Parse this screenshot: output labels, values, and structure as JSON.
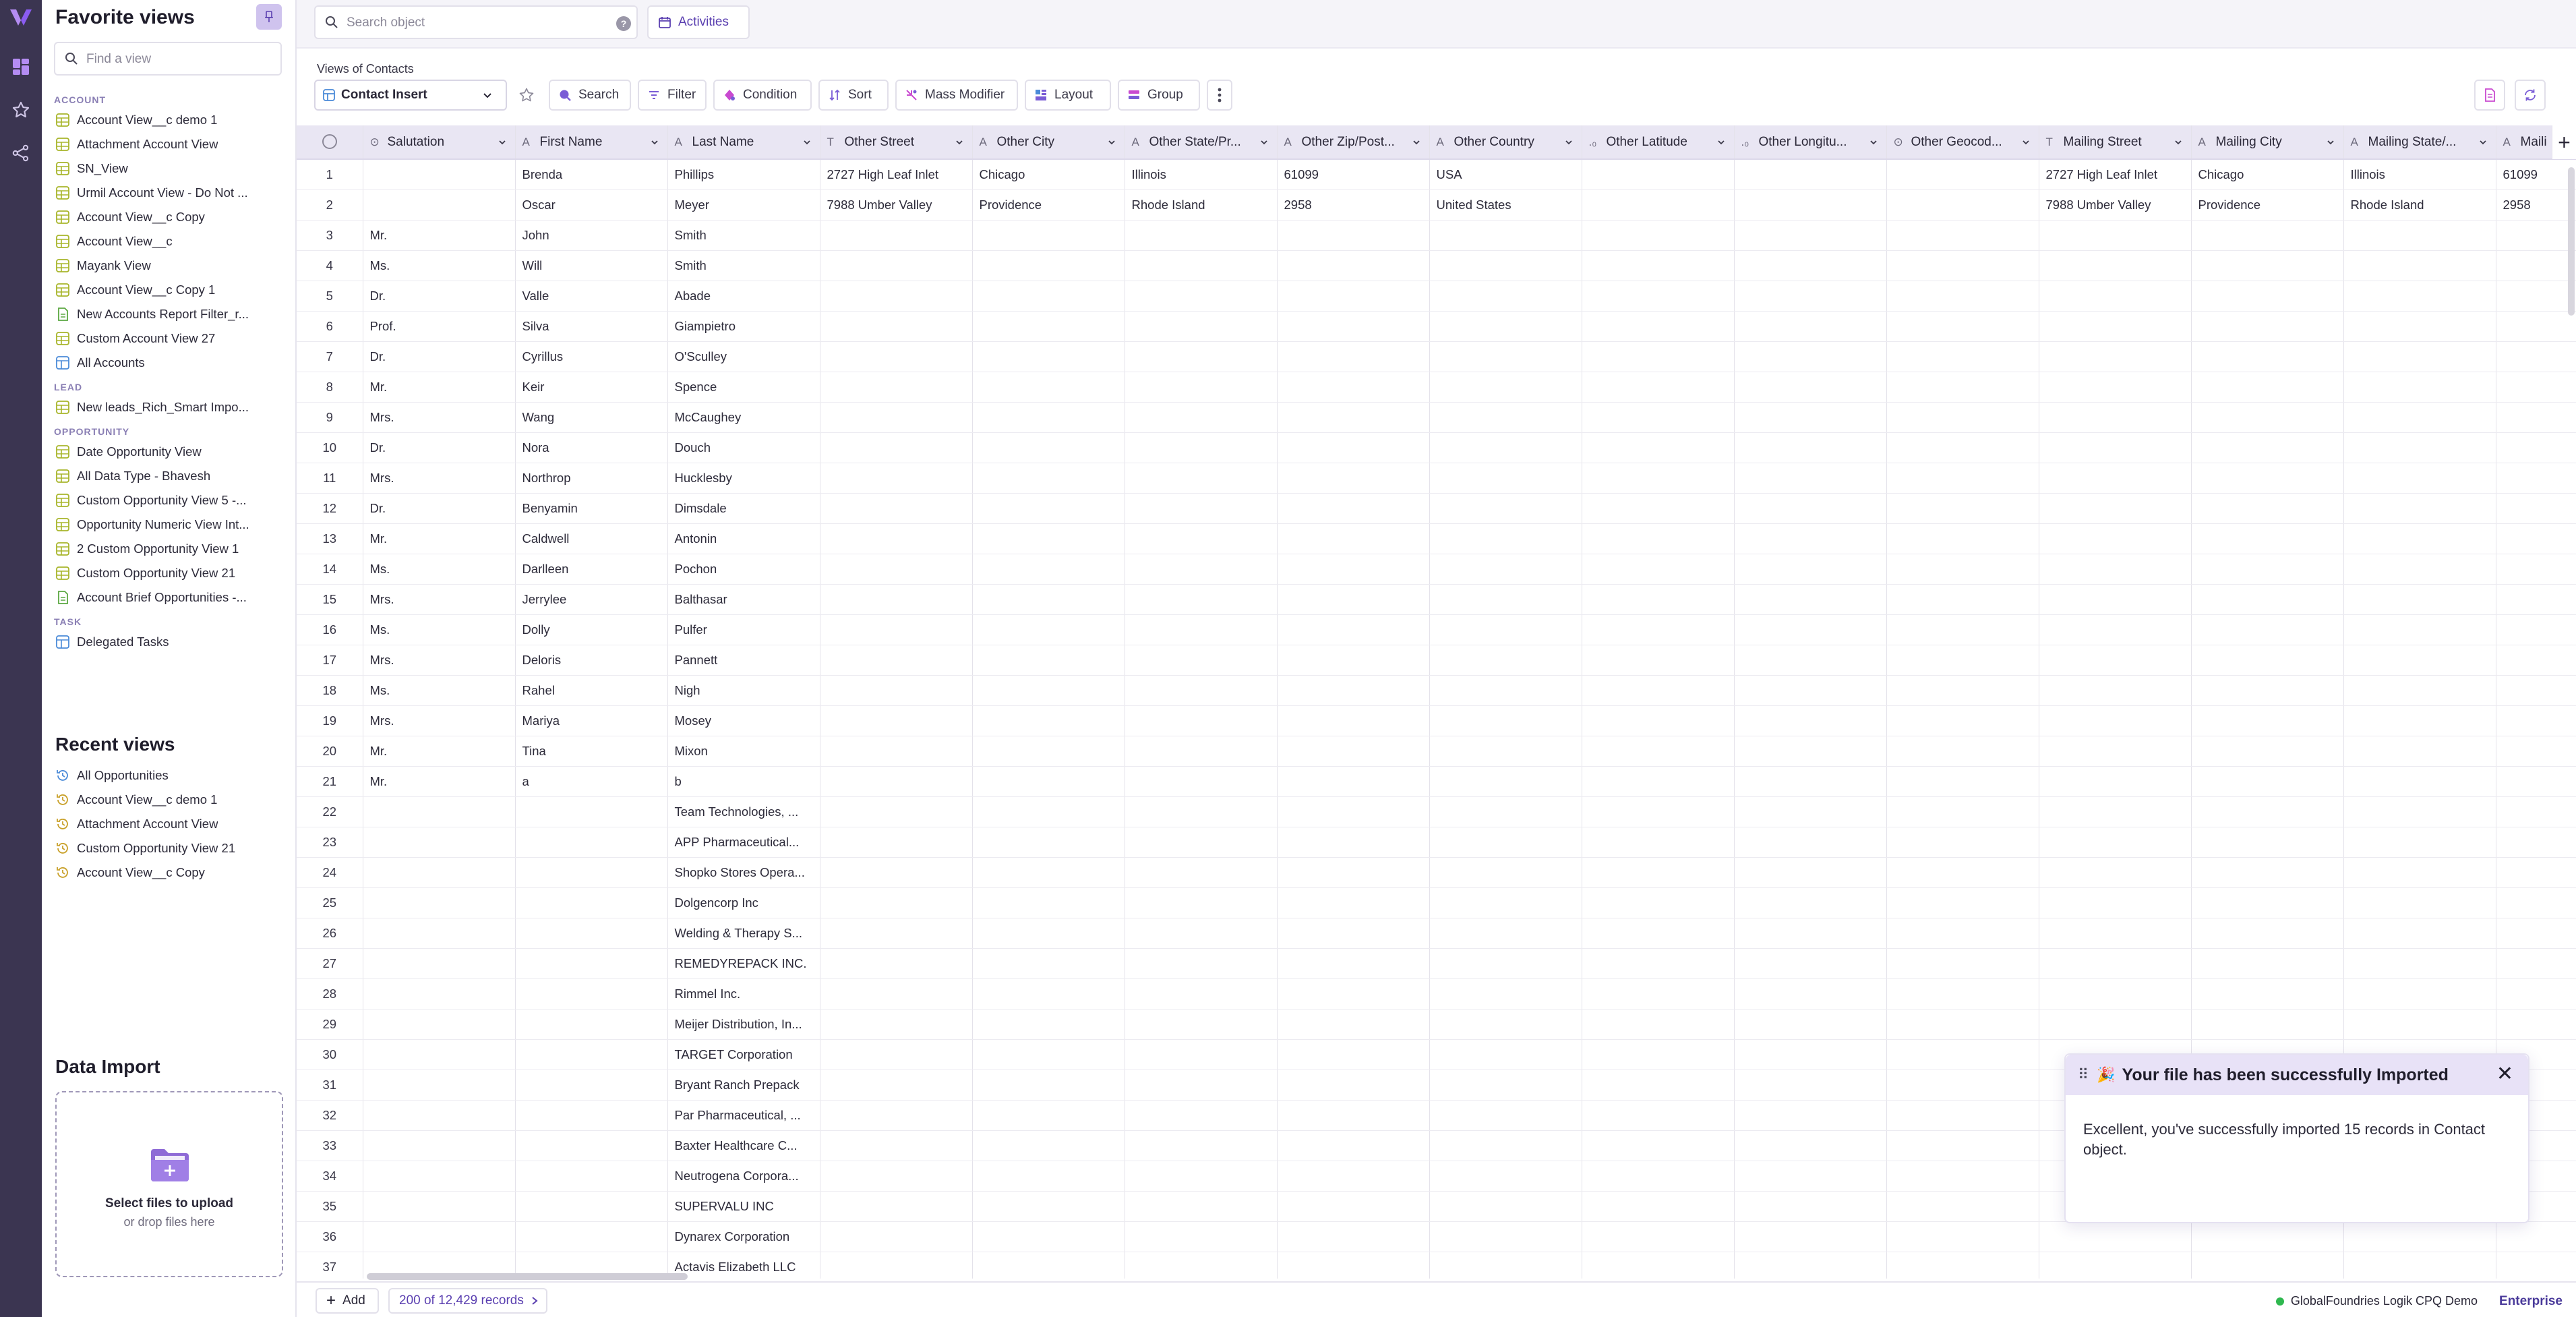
{
  "favorites": {
    "title": "Favorite views",
    "find_placeholder": "Find a view",
    "sections": [
      {
        "label": "ACCOUNT",
        "items": [
          {
            "label": "Account View__c demo 1",
            "icon": "grid-view-icon"
          },
          {
            "label": "Attachment Account View",
            "icon": "grid-view-icon"
          },
          {
            "label": "SN_View",
            "icon": "grid-view-icon"
          },
          {
            "label": "Urmil Account View - Do Not ...",
            "icon": "grid-view-icon"
          },
          {
            "label": "Account View__c Copy",
            "icon": "grid-view-icon"
          },
          {
            "label": "Account View__c",
            "icon": "grid-view-icon"
          },
          {
            "label": "Mayank View",
            "icon": "grid-view-icon"
          },
          {
            "label": "Account View__c Copy 1",
            "icon": "grid-view-icon"
          },
          {
            "label": "New Accounts Report Filter_r...",
            "icon": "report-view-icon"
          },
          {
            "label": "Custom Account View 27",
            "icon": "grid-view-icon"
          },
          {
            "label": "All Accounts",
            "icon": "list-view-icon"
          }
        ]
      },
      {
        "label": "LEAD",
        "items": [
          {
            "label": "New leads_Rich_Smart Impo...",
            "icon": "grid-view-icon"
          }
        ]
      },
      {
        "label": "OPPORTUNITY",
        "items": [
          {
            "label": "Date Opportunity View",
            "icon": "grid-view-icon"
          },
          {
            "label": "All Data Type - Bhavesh",
            "icon": "grid-view-icon"
          },
          {
            "label": "Custom Opportunity View 5 -...",
            "icon": "grid-view-icon"
          },
          {
            "label": "Opportunity Numeric View Int...",
            "icon": "grid-view-icon"
          },
          {
            "label": "2 Custom Opportunity View 1",
            "icon": "grid-view-icon"
          },
          {
            "label": "Custom Opportunity View 21",
            "icon": "grid-view-icon"
          },
          {
            "label": "Account Brief Opportunities -...",
            "icon": "report-view-icon"
          }
        ]
      },
      {
        "label": "TASK",
        "items": [
          {
            "label": "Delegated Tasks",
            "icon": "list-view-icon"
          }
        ]
      }
    ]
  },
  "recent": {
    "title": "Recent views",
    "items": [
      {
        "label": "All Opportunities",
        "icon": "history-blue-icon"
      },
      {
        "label": "Account View__c demo 1",
        "icon": "history-icon"
      },
      {
        "label": "Attachment Account View",
        "icon": "history-icon"
      },
      {
        "label": "Custom Opportunity View 21",
        "icon": "history-icon"
      },
      {
        "label": "Account View__c Copy",
        "icon": "history-icon"
      }
    ]
  },
  "data_import": {
    "title": "Data Import",
    "select_label": "Select files to upload",
    "drop_label": "or drop files here"
  },
  "topbar": {
    "search_placeholder": "Search object",
    "help": "?",
    "activities_label": "Activities"
  },
  "views_of": "Views of Contacts",
  "toolbar": {
    "view_name": "Contact Insert",
    "search": "Search",
    "filter": "Filter",
    "condition": "Condition",
    "sort": "Sort",
    "mass_modifier": "Mass Modifier",
    "layout": "Layout",
    "group": "Group"
  },
  "columns": [
    {
      "label": "Salutation",
      "icon": "picklist-icon"
    },
    {
      "label": "First Name",
      "icon": "text-icon"
    },
    {
      "label": "Last Name",
      "icon": "text-icon"
    },
    {
      "label": "Other Street",
      "icon": "textarea-icon"
    },
    {
      "label": "Other City",
      "icon": "text-icon"
    },
    {
      "label": "Other State/Pr...",
      "icon": "text-icon"
    },
    {
      "label": "Other Zip/Post...",
      "icon": "text-icon"
    },
    {
      "label": "Other Country",
      "icon": "text-icon"
    },
    {
      "label": "Other Latitude",
      "icon": "number-icon"
    },
    {
      "label": "Other Longitu...",
      "icon": "number-icon"
    },
    {
      "label": "Other Geocod...",
      "icon": "picklist-icon"
    },
    {
      "label": "Mailing Street",
      "icon": "textarea-icon"
    },
    {
      "label": "Mailing City",
      "icon": "text-icon"
    },
    {
      "label": "Mailing State/...",
      "icon": "text-icon"
    },
    {
      "label": "Maili",
      "icon": "text-icon"
    }
  ],
  "rows": [
    [
      "1",
      "",
      "Brenda",
      "Phillips",
      "2727 High Leaf Inlet",
      "Chicago",
      "Illinois",
      "61099",
      "USA",
      "",
      "",
      "",
      "2727 High Leaf Inlet",
      "Chicago",
      "Illinois",
      "61099"
    ],
    [
      "2",
      "",
      "Oscar",
      "Meyer",
      "7988 Umber Valley",
      "Providence",
      "Rhode Island",
      "2958",
      "United States",
      "",
      "",
      "",
      "7988 Umber Valley",
      "Providence",
      "Rhode Island",
      "2958"
    ],
    [
      "3",
      "Mr.",
      "John",
      "Smith",
      "",
      "",
      "",
      "",
      "",
      "",
      "",
      "",
      "",
      "",
      "",
      ""
    ],
    [
      "4",
      "Ms.",
      "Will",
      "Smith",
      "",
      "",
      "",
      "",
      "",
      "",
      "",
      "",
      "",
      "",
      "",
      ""
    ],
    [
      "5",
      "Dr.",
      "Valle",
      "Abade",
      "",
      "",
      "",
      "",
      "",
      "",
      "",
      "",
      "",
      "",
      "",
      ""
    ],
    [
      "6",
      "Prof.",
      "Silva",
      "Giampietro",
      "",
      "",
      "",
      "",
      "",
      "",
      "",
      "",
      "",
      "",
      "",
      ""
    ],
    [
      "7",
      "Dr.",
      "Cyrillus",
      "O'Sculley",
      "",
      "",
      "",
      "",
      "",
      "",
      "",
      "",
      "",
      "",
      "",
      ""
    ],
    [
      "8",
      "Mr.",
      "Keir",
      "Spence",
      "",
      "",
      "",
      "",
      "",
      "",
      "",
      "",
      "",
      "",
      "",
      ""
    ],
    [
      "9",
      "Mrs.",
      "Wang",
      "McCaughey",
      "",
      "",
      "",
      "",
      "",
      "",
      "",
      "",
      "",
      "",
      "",
      ""
    ],
    [
      "10",
      "Dr.",
      "Nora",
      "Douch",
      "",
      "",
      "",
      "",
      "",
      "",
      "",
      "",
      "",
      "",
      "",
      ""
    ],
    [
      "11",
      "Mrs.",
      "Northrop",
      "Hucklesby",
      "",
      "",
      "",
      "",
      "",
      "",
      "",
      "",
      "",
      "",
      "",
      ""
    ],
    [
      "12",
      "Dr.",
      "Benyamin",
      "Dimsdale",
      "",
      "",
      "",
      "",
      "",
      "",
      "",
      "",
      "",
      "",
      "",
      ""
    ],
    [
      "13",
      "Mr.",
      "Caldwell",
      "Antonin",
      "",
      "",
      "",
      "",
      "",
      "",
      "",
      "",
      "",
      "",
      "",
      ""
    ],
    [
      "14",
      "Ms.",
      "Darlleen",
      "Pochon",
      "",
      "",
      "",
      "",
      "",
      "",
      "",
      "",
      "",
      "",
      "",
      ""
    ],
    [
      "15",
      "Mrs.",
      "Jerrylee",
      "Balthasar",
      "",
      "",
      "",
      "",
      "",
      "",
      "",
      "",
      "",
      "",
      "",
      ""
    ],
    [
      "16",
      "Ms.",
      "Dolly",
      "Pulfer",
      "",
      "",
      "",
      "",
      "",
      "",
      "",
      "",
      "",
      "",
      "",
      ""
    ],
    [
      "17",
      "Mrs.",
      "Deloris",
      "Pannett",
      "",
      "",
      "",
      "",
      "",
      "",
      "",
      "",
      "",
      "",
      "",
      ""
    ],
    [
      "18",
      "Ms.",
      "Rahel",
      "Nigh",
      "",
      "",
      "",
      "",
      "",
      "",
      "",
      "",
      "",
      "",
      "",
      ""
    ],
    [
      "19",
      "Mrs.",
      "Mariya",
      "Mosey",
      "",
      "",
      "",
      "",
      "",
      "",
      "",
      "",
      "",
      "",
      "",
      ""
    ],
    [
      "20",
      "Mr.",
      "Tina",
      "Mixon",
      "",
      "",
      "",
      "",
      "",
      "",
      "",
      "",
      "",
      "",
      "",
      ""
    ],
    [
      "21",
      "Mr.",
      "a",
      "b",
      "",
      "",
      "",
      "",
      "",
      "",
      "",
      "",
      "",
      "",
      "",
      ""
    ],
    [
      "22",
      "",
      "",
      "Team Technologies, ...",
      "",
      "",
      "",
      "",
      "",
      "",
      "",
      "",
      "",
      "",
      "",
      ""
    ],
    [
      "23",
      "",
      "",
      "APP Pharmaceutical...",
      "",
      "",
      "",
      "",
      "",
      "",
      "",
      "",
      "",
      "",
      "",
      ""
    ],
    [
      "24",
      "",
      "",
      "Shopko Stores Opera...",
      "",
      "",
      "",
      "",
      "",
      "",
      "",
      "",
      "",
      "",
      "",
      ""
    ],
    [
      "25",
      "",
      "",
      "Dolgencorp Inc",
      "",
      "",
      "",
      "",
      "",
      "",
      "",
      "",
      "",
      "",
      "",
      ""
    ],
    [
      "26",
      "",
      "",
      "Welding & Therapy S...",
      "",
      "",
      "",
      "",
      "",
      "",
      "",
      "",
      "",
      "",
      "",
      ""
    ],
    [
      "27",
      "",
      "",
      "REMEDYREPACK INC.",
      "",
      "",
      "",
      "",
      "",
      "",
      "",
      "",
      "",
      "",
      "",
      ""
    ],
    [
      "28",
      "",
      "",
      "Rimmel Inc.",
      "",
      "",
      "",
      "",
      "",
      "",
      "",
      "",
      "",
      "",
      "",
      ""
    ],
    [
      "29",
      "",
      "",
      "Meijer Distribution, In...",
      "",
      "",
      "",
      "",
      "",
      "",
      "",
      "",
      "",
      "",
      "",
      ""
    ],
    [
      "30",
      "",
      "",
      "TARGET Corporation",
      "",
      "",
      "",
      "",
      "",
      "",
      "",
      "",
      "",
      "",
      "",
      ""
    ],
    [
      "31",
      "",
      "",
      "Bryant Ranch Prepack",
      "",
      "",
      "",
      "",
      "",
      "",
      "",
      "",
      "",
      "",
      "",
      ""
    ],
    [
      "32",
      "",
      "",
      "Par Pharmaceutical, ...",
      "",
      "",
      "",
      "",
      "",
      "",
      "",
      "",
      "",
      "",
      "",
      ""
    ],
    [
      "33",
      "",
      "",
      "Baxter Healthcare C...",
      "",
      "",
      "",
      "",
      "",
      "",
      "",
      "",
      "",
      "",
      "",
      ""
    ],
    [
      "34",
      "",
      "",
      "Neutrogena Corpora...",
      "",
      "",
      "",
      "",
      "",
      "",
      "",
      "",
      "",
      "",
      "",
      ""
    ],
    [
      "35",
      "",
      "",
      "SUPERVALU INC",
      "",
      "",
      "",
      "",
      "",
      "",
      "",
      "",
      "",
      "",
      "",
      ""
    ],
    [
      "36",
      "",
      "",
      "Dynarex Corporation",
      "",
      "",
      "",
      "",
      "",
      "",
      "",
      "",
      "",
      "",
      "",
      ""
    ],
    [
      "37",
      "",
      "",
      "Actavis Elizabeth LLC",
      "",
      "",
      "",
      "",
      "",
      "",
      "",
      "",
      "",
      "",
      "",
      ""
    ]
  ],
  "footer": {
    "add_label": "Add",
    "records_label": "200 of 12,429 records",
    "org_name": "GlobalFoundries Logik CPQ Demo",
    "edition": "Enterprise"
  },
  "toast": {
    "title": "Your file has been successfully Imported",
    "message": "Excellent, you've successfully imported 15 records in Contact object."
  },
  "colors": {
    "rail": "#3b3551",
    "accent": "#5a3fb0",
    "header_bg": "#e9e6f3",
    "status_online": "#2fb84f"
  }
}
